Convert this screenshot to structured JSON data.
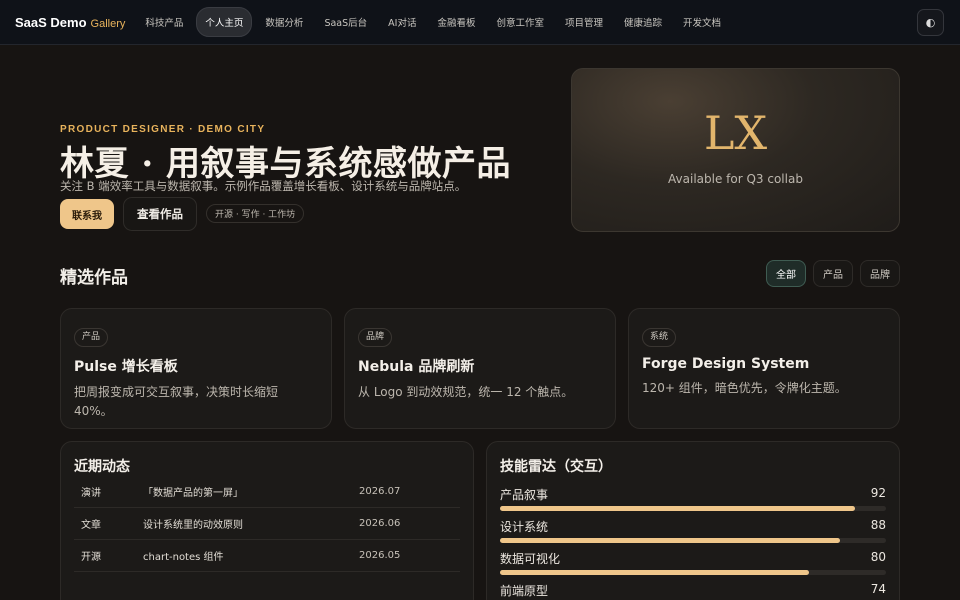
{
  "nav": {
    "brand": "SaaS Demo",
    "brand_suffix": "Gallery",
    "items": [
      {
        "label": "科技产品",
        "active": false
      },
      {
        "label": "个人主页",
        "active": true
      },
      {
        "label": "数据分析",
        "active": false
      },
      {
        "label": "SaaS后台",
        "active": false
      },
      {
        "label": "AI对话",
        "active": false
      },
      {
        "label": "金融看板",
        "active": false
      },
      {
        "label": "创意工作室",
        "active": false
      },
      {
        "label": "项目管理",
        "active": false
      },
      {
        "label": "健康追踪",
        "active": false
      },
      {
        "label": "开发文档",
        "active": false
      }
    ],
    "theme_icon": "◐"
  },
  "hero": {
    "eyebrow": "PRODUCT DESIGNER · DEMO CITY",
    "title": "林夏 · 用叙事与系统感做产品",
    "subtitle": "关注 B 端效率工具与数据叙事。示例作品覆盖增长看板、设计系统与品牌站点。",
    "contact_label": "联系我",
    "works_label": "查看作品",
    "chip": "开源 · 写作 · 工作坊"
  },
  "profile": {
    "initials": "LX",
    "status": "Available for Q3 collab"
  },
  "works": {
    "title": "精选作品",
    "filters": [
      {
        "label": "全部",
        "active": true
      },
      {
        "label": "产品",
        "active": false
      },
      {
        "label": "品牌",
        "active": false
      }
    ],
    "cards": [
      {
        "tag": "产品",
        "title": "Pulse 增长看板",
        "desc": "把周报变成可交互叙事，决策时长缩短 40%。"
      },
      {
        "tag": "品牌",
        "title": "Nebula 品牌刷新",
        "desc": "从 Logo 到动效规范，统一 12 个触点。"
      },
      {
        "tag": "系统",
        "title": "Forge Design System",
        "desc": "120+ 组件，暗色优先，令牌化主题。"
      }
    ]
  },
  "activity": {
    "title": "近期动态",
    "rows": [
      {
        "type": "演讲",
        "name": "「数据产品的第一屏」",
        "date": "2026.07"
      },
      {
        "type": "文章",
        "name": "设计系统里的动效原则",
        "date": "2026.06"
      },
      {
        "type": "开源",
        "name": "chart-notes 组件",
        "date": "2026.05"
      }
    ]
  },
  "skills": {
    "title": "技能雷达（交互）",
    "items": [
      {
        "name": "产品叙事",
        "value": 92
      },
      {
        "name": "设计系统",
        "value": 88
      },
      {
        "name": "数据可视化",
        "value": 80
      },
      {
        "name": "前端原型",
        "value": 74
      }
    ]
  }
}
